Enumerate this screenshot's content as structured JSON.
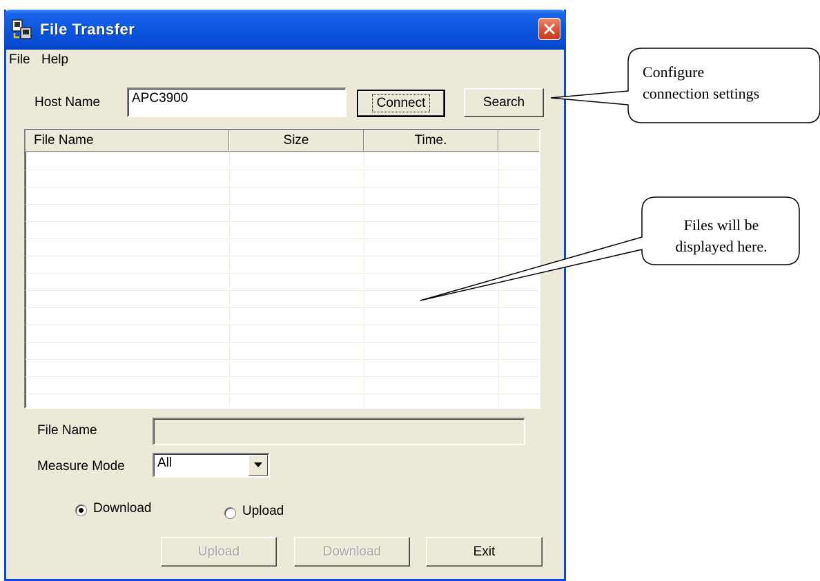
{
  "window": {
    "title": "File Transfer",
    "app_icon": "network-transfer-icon",
    "close_icon": "close-icon"
  },
  "menu": {
    "items": [
      "File",
      "Help"
    ]
  },
  "connection": {
    "host_label": "Host Name",
    "host_value": "APC3900",
    "connect_label": "Connect",
    "search_label": "Search"
  },
  "file_list": {
    "columns": [
      "File Name",
      "Size",
      "Time.",
      ""
    ],
    "rows": []
  },
  "form": {
    "file_name_label": "File Name",
    "file_name_value": "",
    "measure_mode_label": "Measure Mode",
    "measure_mode_value": "All"
  },
  "mode": {
    "download_label": "Download",
    "upload_label": "Upload",
    "selected": "Download"
  },
  "actions": {
    "upload_label": "Upload",
    "download_label": "Download",
    "exit_label": "Exit"
  },
  "callouts": {
    "connection": {
      "line1": "Configure",
      "line2": "connection settings"
    },
    "files": {
      "line1": "Files will be",
      "line2": "displayed here."
    }
  }
}
